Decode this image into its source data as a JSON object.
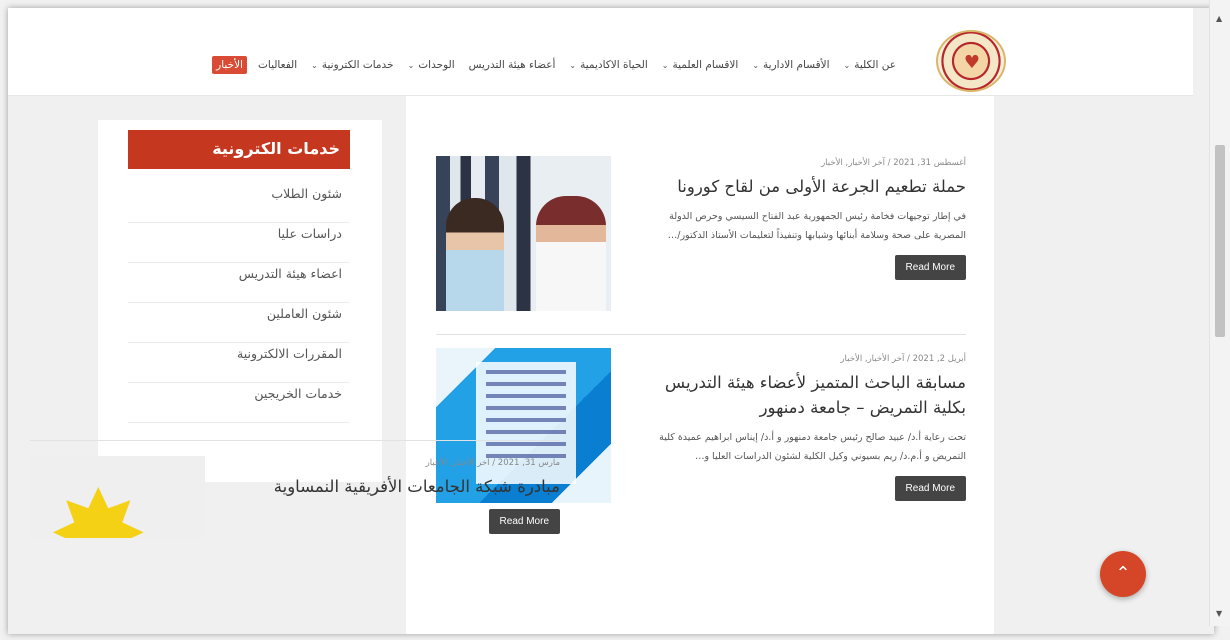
{
  "nav": {
    "items": [
      {
        "label": "عن الكلية",
        "chevron": true
      },
      {
        "label": "الأقسام الادارية",
        "chevron": true
      },
      {
        "label": "الاقسام العلمية",
        "chevron": true
      },
      {
        "label": "الحياة الاكاديمية",
        "chevron": true
      },
      {
        "label": "أعضاء هيئة التدريس",
        "chevron": false
      },
      {
        "label": "الوحدات",
        "chevron": true
      },
      {
        "label": "خدمات الكترونية",
        "chevron": true
      },
      {
        "label": "الفعاليات",
        "chevron": false
      }
    ],
    "active_label": "الأخبار"
  },
  "sidebar": {
    "title": "خدمات الكترونية",
    "items": [
      "شئون الطلاب",
      "دراسات عليا",
      "اعضاء هيئة التدريس",
      "شئون العاملين",
      "المقررات الالكترونية",
      "خدمات الخريجين"
    ]
  },
  "posts": [
    {
      "meta": "أغسطس 31, 2021 / آخر الأخبار, الأخبار",
      "title": "حملة تطعيم الجرعة الأولى من لقاح كورونا",
      "excerpt": "في إطار توجيهات فخامة رئيس الجمهورية عبد الفتاح السيسي وحرص الدولة المصرية على صحة وسلامة أبنائها وشبابها وتنفيذاً لتعليمات الأستاذ الدكتور/…",
      "button": "Read More"
    },
    {
      "meta": "أبريل 2, 2021 / آخر الأخبار, الأخبار",
      "title": "مسابقة الباحث المتميز لأعضاء هيئة التدريس بكلية التمريض – جامعة دمنهور",
      "excerpt": "تحت رعاية أ.د/ عبيد صالح رئيس جامعة دمنهور و أ.د/ إيناس ابراهيم عميدة كلية التمريض و أ.م.د/ ريم بسيوني وكيل الكلية لشئون الدراسات العليا و…",
      "button": "Read More"
    },
    {
      "meta": "مارس 31, 2021 / آخر الأخبار, الأخبار",
      "title": "مبادرة شبكة الجامعات الأفريقية النمساوية",
      "excerpt": "",
      "button": "Read More"
    }
  ],
  "icons": {
    "back_to_top": "chevron-up-icon",
    "nav_chevron": "chevron-down-icon"
  },
  "colors": {
    "accent": "#c6371f",
    "button": "#444444",
    "fab": "#d54527"
  }
}
